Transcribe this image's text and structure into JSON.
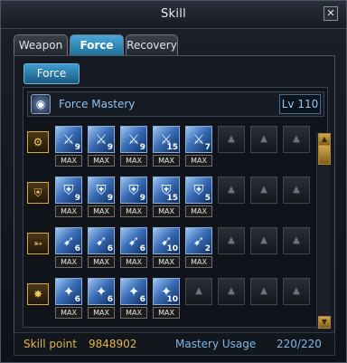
{
  "window": {
    "title": "Skill",
    "close": "✕"
  },
  "tabs": [
    {
      "label": "Weapon",
      "active": false
    },
    {
      "label": "Force",
      "active": true
    },
    {
      "label": "Recovery",
      "active": false
    }
  ],
  "subtab": {
    "label": "Force"
  },
  "mastery": {
    "icon": "force-mastery-icon",
    "name": "Force Mastery",
    "level": "Lv 110"
  },
  "rows": [
    {
      "category_icon": "gear-category-icon",
      "skills": [
        {
          "icon": "sword-skill-icon",
          "level": "9",
          "max": "MAX"
        },
        {
          "icon": "sword-skill-icon",
          "level": "9",
          "max": "MAX"
        },
        {
          "icon": "sword-skill-icon",
          "level": "9",
          "max": "MAX"
        },
        {
          "icon": "sword-skill-icon",
          "level": "15",
          "max": "MAX"
        },
        {
          "icon": "sword-skill-icon",
          "level": "7",
          "max": "MAX"
        }
      ]
    },
    {
      "category_icon": "shield-category-icon",
      "skills": [
        {
          "icon": "shield-skill-icon",
          "level": "9",
          "max": "MAX"
        },
        {
          "icon": "shield-skill-icon",
          "level": "9",
          "max": "MAX"
        },
        {
          "icon": "shield-skill-icon",
          "level": "9",
          "max": "MAX"
        },
        {
          "icon": "shield-skill-icon",
          "level": "15",
          "max": "MAX"
        },
        {
          "icon": "shield-skill-icon",
          "level": "5",
          "max": "MAX"
        }
      ]
    },
    {
      "category_icon": "bolt-category-icon",
      "skills": [
        {
          "icon": "bolt-skill-icon",
          "level": "6",
          "max": "MAX"
        },
        {
          "icon": "bolt-skill-icon",
          "level": "6",
          "max": "MAX"
        },
        {
          "icon": "bolt-skill-icon",
          "level": "6",
          "max": "MAX"
        },
        {
          "icon": "bolt-skill-icon",
          "level": "10",
          "max": "MAX"
        },
        {
          "icon": "bolt-skill-icon",
          "level": "2",
          "max": "MAX"
        }
      ]
    },
    {
      "category_icon": "burst-category-icon",
      "skills": [
        {
          "icon": "ice-skill-icon",
          "level": "6",
          "max": "MAX"
        },
        {
          "icon": "ice-skill-icon",
          "level": "6",
          "max": "MAX"
        },
        {
          "icon": "ice-skill-icon",
          "level": "6",
          "max": "MAX"
        },
        {
          "icon": "ice-skill-icon",
          "level": "10",
          "max": "MAX"
        }
      ]
    }
  ],
  "footer": {
    "skill_point_label": "Skill point",
    "skill_point_value": "9848902",
    "mastery_usage_label": "Mastery Usage",
    "mastery_usage_value": "220/220"
  }
}
